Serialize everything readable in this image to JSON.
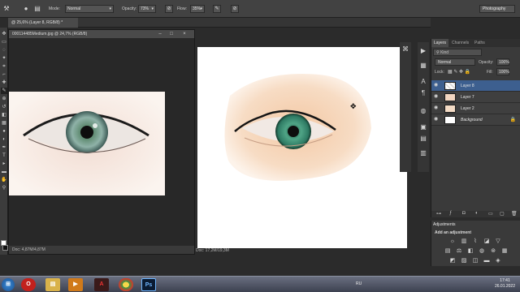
{
  "options_bar": {
    "mode_label": "Mode:",
    "mode_value": "Normal",
    "opacity_label": "Opacity:",
    "opacity_value": "73%",
    "flow_label": "Flow:",
    "flow_value": "35%",
    "workspace_value": "Photography"
  },
  "document_tab": {
    "title": "@ 25,6% (Layer 8, RGB/8) *"
  },
  "float_window": {
    "title": "000114485Medium.jpg @ 24,7% (RGB/8)",
    "status": "Doc: 4,87M/4,87M"
  },
  "main_status": {
    "text": "Doc: 17,2M/19,3M"
  },
  "layers_panel": {
    "tabs": [
      "Layers",
      "Channels",
      "Paths"
    ],
    "kind_label": "Kind",
    "blend_mode": "Normal",
    "opacity_label": "Opacity:",
    "opacity_value": "100%",
    "lock_label": "Lock:",
    "fill_label": "Fill:",
    "fill_value": "100%",
    "layers": [
      {
        "name": "Layer 8",
        "selected": true
      },
      {
        "name": "Layer 7",
        "selected": false
      },
      {
        "name": "Layer 2",
        "selected": false
      },
      {
        "name": "Background",
        "selected": false
      }
    ]
  },
  "adjustments_panel": {
    "title": "Adjustments",
    "subtitle": "Add an adjustment"
  },
  "taskbar": {
    "apps": [
      "Opera",
      "File Explorer",
      "Media Player",
      "Adobe",
      "Chrome",
      "Photoshop"
    ],
    "language": "RU",
    "time": "17:41",
    "date": "26.01.2022"
  }
}
